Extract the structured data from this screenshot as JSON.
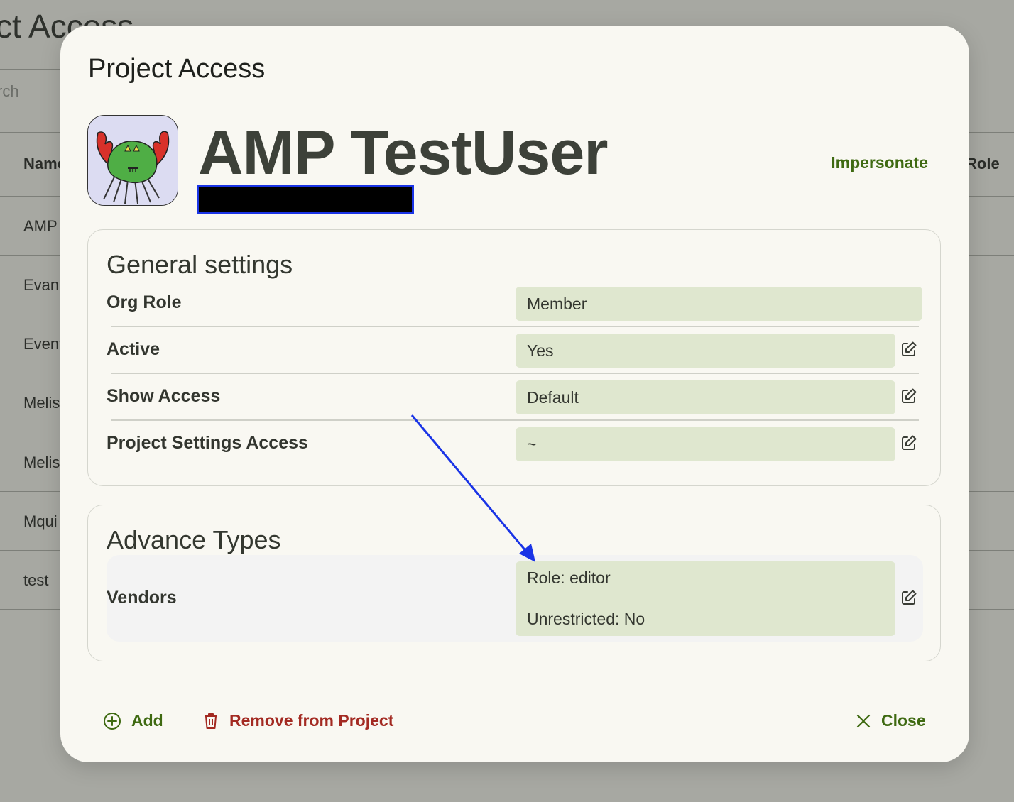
{
  "background": {
    "title": "ct Access",
    "search_placeholder": "rch",
    "headers": {
      "name": "Name",
      "role": "Role"
    },
    "rows": [
      "AMP",
      "Evan",
      "Event",
      "Melis",
      "Melis",
      "Mqui",
      "test"
    ]
  },
  "modal": {
    "title": "Project Access",
    "user_name": "AMP TestUser",
    "impersonate_label": "Impersonate",
    "general": {
      "title": "General settings",
      "fields": [
        {
          "label": "Org Role",
          "value": "Member"
        },
        {
          "label": "Active",
          "value": "Yes"
        },
        {
          "label": "Show Access",
          "value": "Default"
        },
        {
          "label": "Project Settings Access",
          "value": "~"
        }
      ]
    },
    "advance": {
      "title": "Advance Types",
      "vendors_label": "Vendors",
      "vendors_role": "Role: editor",
      "vendors_unrestricted": "Unrestricted: No"
    },
    "footer": {
      "add_label": "Add",
      "remove_label": "Remove from Project",
      "close_label": "Close"
    }
  },
  "colors": {
    "accent_green": "#3f6a12",
    "danger_red": "#a32a22",
    "field_bg": "#dfe7cf",
    "annotation_arrow": "#1a34e6"
  },
  "icons": [
    "avatar-crab-image",
    "edit-icon",
    "add-circle-icon",
    "trash-icon",
    "close-icon"
  ]
}
